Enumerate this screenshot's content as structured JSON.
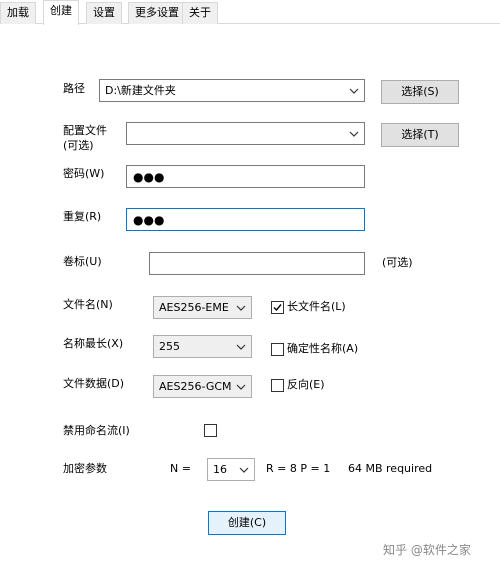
{
  "tabs": [
    {
      "label": "加载"
    },
    {
      "label": "创建",
      "active": true
    },
    {
      "label": "设置"
    },
    {
      "label": "更多设置"
    },
    {
      "label": "关于"
    }
  ],
  "path": {
    "label": "路径",
    "value": "D:\\新建文件夹",
    "choose_button": "选择(S)"
  },
  "config": {
    "label_line1": "配置文件",
    "label_line2": "(可选)",
    "value": "",
    "choose_button": "选择(T)"
  },
  "password": {
    "label": "密码(W)",
    "mask": "●●●"
  },
  "repeat": {
    "label": "重复(R)",
    "mask": "●●●"
  },
  "volume": {
    "label": "卷标(U)",
    "value": "",
    "hint": "(可选)"
  },
  "filename": {
    "label": "文件名(N)",
    "value": "AES256-EME",
    "checkbox_label": "长文件名(L)",
    "checked": true
  },
  "max_name": {
    "label": "名称最长(X)",
    "value": "255",
    "checkbox_label": "确定性名称(A)",
    "checked": false
  },
  "file_data": {
    "label": "文件数据(D)",
    "value": "AES256-GCM",
    "checkbox_label": "反向(E)",
    "checked": false
  },
  "disable_streams": {
    "label": "禁用命名流(I)",
    "checked": false
  },
  "crypto": {
    "label": "加密参数",
    "n_label": "N =",
    "n_value": "16",
    "rp_text": "R = 8  P = 1",
    "mem_text": "64 MB required"
  },
  "create_button": "创建(C)",
  "watermark": "知乎 @软件之家",
  "colors": {
    "accent": "#0078d7",
    "button_bg": "#e1e1e1",
    "tab_bg": "#f0f0f0"
  }
}
